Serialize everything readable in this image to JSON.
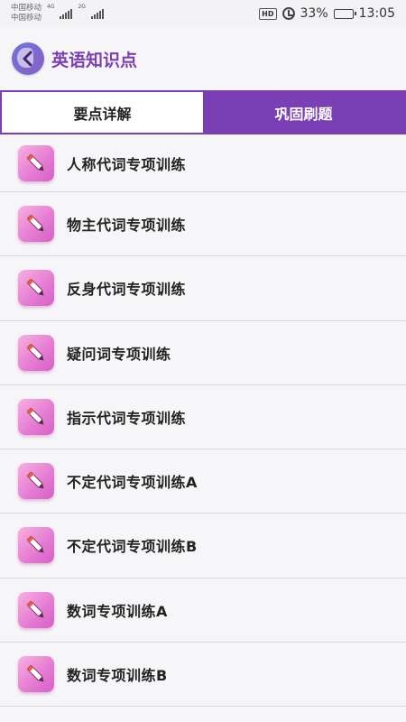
{
  "status_bar": {
    "carrier_1": "中国移动",
    "carrier_2": "中国移动",
    "network_1": "4G",
    "network_2": "2G",
    "hd_label": "HD",
    "battery_percent": "33%",
    "battery_level": 0.33,
    "time": "13:05"
  },
  "header": {
    "title": "英语知识点",
    "back_icon": "chevron-left-icon"
  },
  "tabs": [
    {
      "label": "要点详解",
      "active": false
    },
    {
      "label": "巩固刷题",
      "active": true
    }
  ],
  "list": {
    "icon": "pen-icon",
    "items": [
      {
        "label": "人称代词专项训练"
      },
      {
        "label": "物主代词专项训练"
      },
      {
        "label": "反身代词专项训练"
      },
      {
        "label": "疑问词专项训练"
      },
      {
        "label": "指示代词专项训练"
      },
      {
        "label": "不定代词专项训练A"
      },
      {
        "label": "不定代词专项训练B"
      },
      {
        "label": "数词专项训练A"
      },
      {
        "label": "数词专项训练B"
      }
    ]
  },
  "colors": {
    "accent": "#7b3fb5",
    "icon_gradient_start": "#f7b0e0",
    "icon_gradient_end": "#d75fc7"
  }
}
